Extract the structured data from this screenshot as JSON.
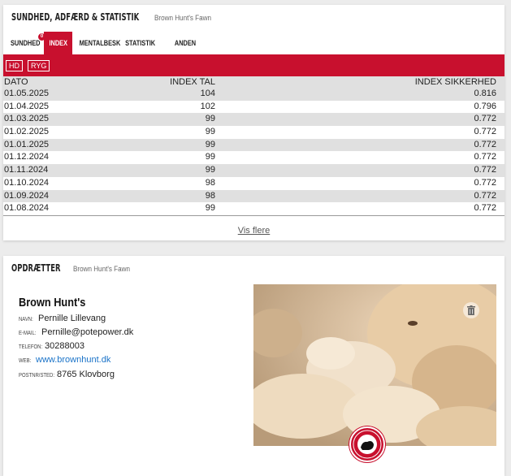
{
  "health_card": {
    "title": "Sundhed, adfærd & statistik",
    "subtitle": "Brown Hunt's Fawn",
    "tabs": [
      {
        "label": "Sundhed",
        "badge": "0"
      },
      {
        "label": "Index",
        "active": true
      },
      {
        "label": "Mentalbesk"
      },
      {
        "label": "Statistik"
      },
      {
        "label": "Anden sundhed"
      }
    ],
    "toggles": [
      "HD",
      "RYG"
    ],
    "table": {
      "headers": [
        "DATO",
        "INDEX TAL",
        "INDEX SIKKERHED"
      ],
      "rows": [
        [
          "01.05.2025",
          "104",
          "0.816"
        ],
        [
          "01.04.2025",
          "102",
          "0.796"
        ],
        [
          "01.03.2025",
          "99",
          "0.772"
        ],
        [
          "01.02.2025",
          "99",
          "0.772"
        ],
        [
          "01.01.2025",
          "99",
          "0.772"
        ],
        [
          "01.12.2024",
          "99",
          "0.772"
        ],
        [
          "01.11.2024",
          "99",
          "0.772"
        ],
        [
          "01.10.2024",
          "98",
          "0.772"
        ],
        [
          "01.09.2024",
          "98",
          "0.772"
        ],
        [
          "01.08.2024",
          "99",
          "0.772"
        ]
      ]
    },
    "more_label": "Vis flere"
  },
  "breeder_card": {
    "title": "Opdrætter",
    "subtitle": "Brown Hunt's Fawn",
    "kennel_name": "Brown Hunt's",
    "fields": {
      "name": {
        "label": "Navn:",
        "value": "Pernille Lillevang"
      },
      "email": {
        "label": "E-mail:",
        "value": "Pernille@potepower.dk"
      },
      "phone": {
        "label": "Telefon:",
        "value": "30288003"
      },
      "web": {
        "label": "Web:",
        "value": "www.brownhunt.dk"
      },
      "postal": {
        "label": "Postnr/sted:",
        "value": "8765 Klovborg"
      }
    },
    "photo_icon": "trash-icon",
    "seal_icon": "breeder-seal-icon"
  },
  "colors": {
    "accent": "#c8102e",
    "row_stripe": "#e0e0e0",
    "link": "#1a73c8"
  }
}
